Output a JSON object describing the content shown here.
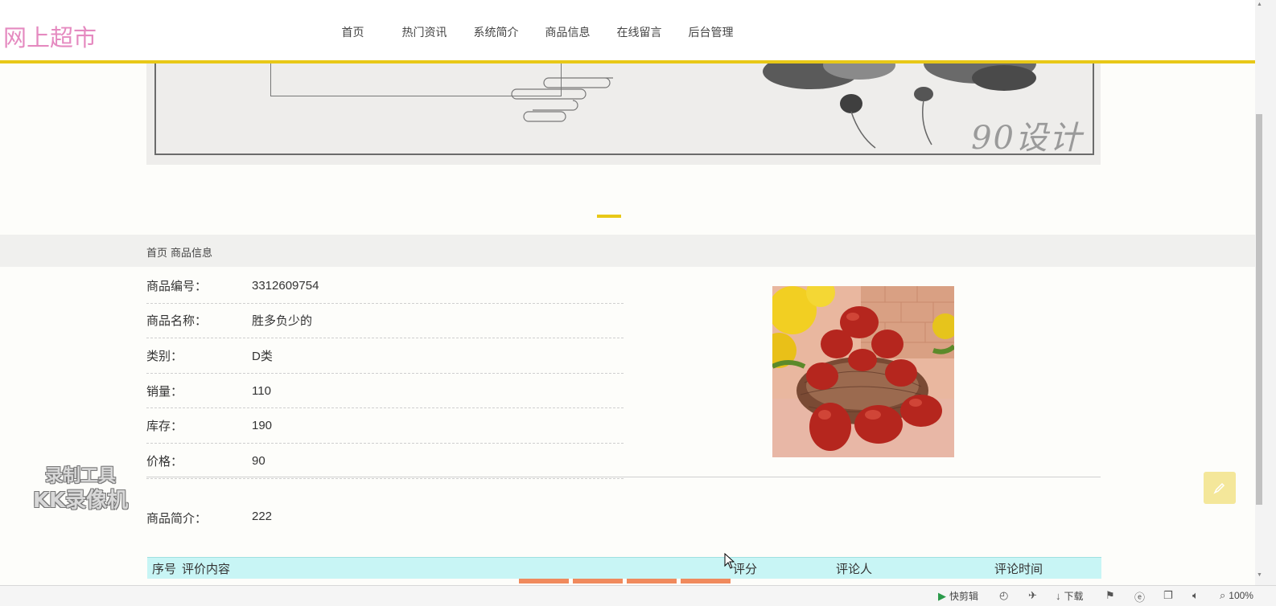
{
  "header": {
    "logo": "网上超市",
    "nav": [
      "首页",
      "热门资讯",
      "系统简介",
      "商品信息",
      "在线留言",
      "后台管理"
    ]
  },
  "banner": {
    "watermark_text": "90设计"
  },
  "breadcrumb": [
    "首页",
    "商品信息"
  ],
  "product": {
    "fields": [
      {
        "label": "商品编号：",
        "value": "3312609754"
      },
      {
        "label": "商品名称：",
        "value": "胜多负少的"
      },
      {
        "label": "类别：",
        "value": "D类"
      },
      {
        "label": "销量：",
        "value": "110"
      },
      {
        "label": "库存：",
        "value": "190"
      },
      {
        "label": "价格：",
        "value": "90"
      }
    ],
    "intro_label": "商品简介：",
    "intro_value": "222"
  },
  "reviews": {
    "columns": [
      "序号",
      "评价内容",
      "评分",
      "评论人",
      "评论时间"
    ]
  },
  "watermark": {
    "line1": "录制工具",
    "line2": "KK录像机"
  },
  "statusbar": {
    "quick_edit": "快剪辑",
    "download": "下载",
    "zoom": "100%"
  },
  "colors": {
    "accent": "#e8c817",
    "logo": "#e58ac0",
    "review_header": "#c8f5f5"
  }
}
